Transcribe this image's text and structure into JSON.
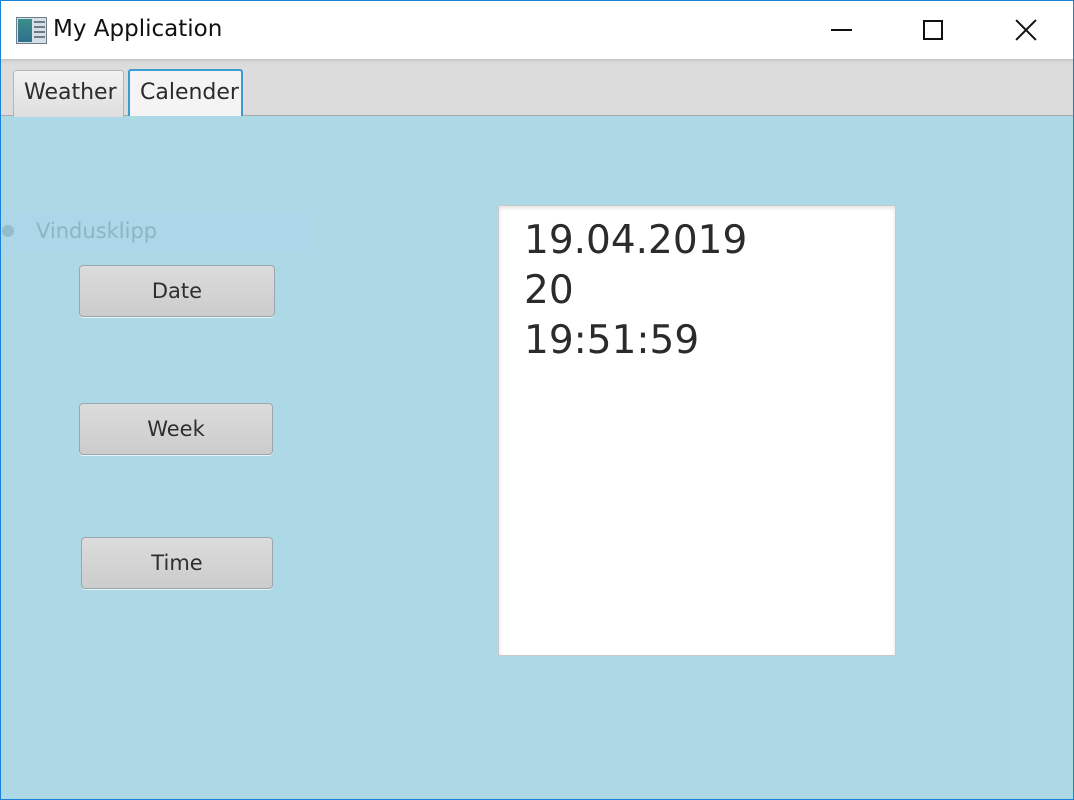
{
  "window": {
    "title": "My Application",
    "icon": "app-window-icon",
    "controls": {
      "minimize": "minimize-icon",
      "maximize": "maximize-icon",
      "close": "close-icon"
    }
  },
  "tabs": [
    {
      "label": "Weather",
      "selected": false
    },
    {
      "label": "Calender",
      "selected": true
    }
  ],
  "overlay": {
    "label": "Vindusklipp"
  },
  "buttons": {
    "date": "Date",
    "week": "Week",
    "time": "Time"
  },
  "output": {
    "lines": [
      "19.04.2019",
      "20",
      "19:51:59"
    ]
  },
  "colors": {
    "content_background": "#add8e6",
    "selected_tab_border": "#3a9bd0",
    "window_border": "#1883d7"
  }
}
